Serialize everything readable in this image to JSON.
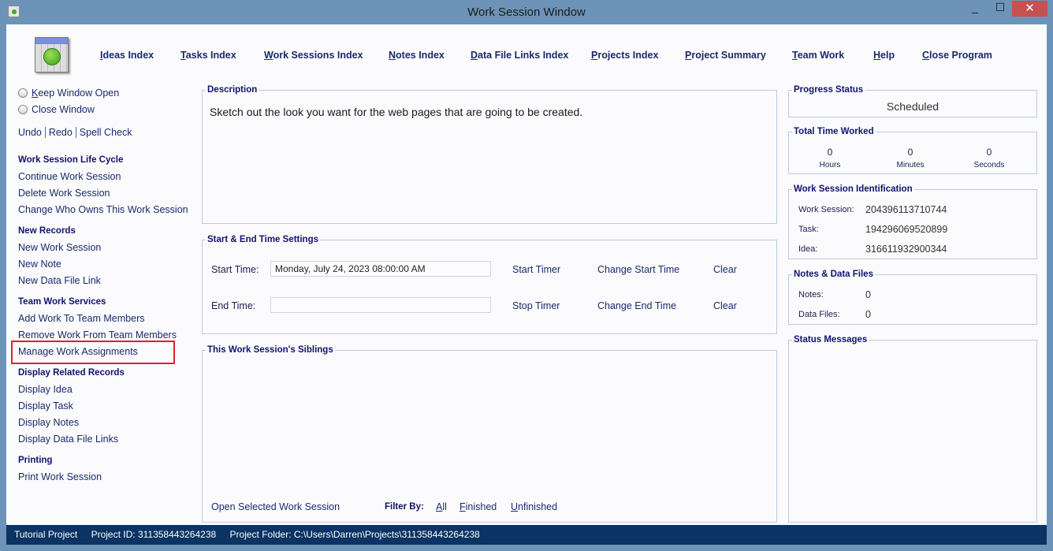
{
  "window": {
    "title": "Work Session Window",
    "minimize": "_",
    "maximize": "☐",
    "close": "✕"
  },
  "nav": [
    "Ideas Index",
    "Tasks Index",
    "Work Sessions Index",
    "Notes Index",
    "Data File Links Index",
    "Projects Index",
    "Project Summary",
    "Team Work",
    "Help",
    "Close Program"
  ],
  "left": {
    "keep_open": "Keep Window Open",
    "close_window": "Close Window",
    "undo": "Undo",
    "redo": "Redo",
    "spell": "Spell Check",
    "sections": [
      {
        "title": "Work Session Life Cycle",
        "items": [
          "Continue Work Session",
          "Delete Work Session",
          "Change Who Owns This Work Session"
        ]
      },
      {
        "title": "New Records",
        "items": [
          "New Work Session",
          "New Note",
          "New Data File Link"
        ]
      },
      {
        "title": "Team Work Services",
        "items": [
          "Add Work To Team Members",
          "Remove Work From Team Members",
          "Manage Work Assignments"
        ]
      },
      {
        "title": "Display Related Records",
        "items": [
          "Display Idea",
          "Display Task",
          "Display Notes",
          "Display Data File Links"
        ]
      },
      {
        "title": "Printing",
        "items": [
          "Print Work Session"
        ]
      }
    ],
    "highlight_color": "#e0202a"
  },
  "description": {
    "label": "Description",
    "text": "Sketch out the look you want for the web pages that are going to be created."
  },
  "times": {
    "label": "Start & End Time Settings",
    "start_label": "Start Time:",
    "start_value": "Monday, July 24, 2023   08:00:00 AM",
    "start_timer": "Start Timer",
    "change_start": "Change Start Time",
    "clear": "Clear",
    "end_label": "End Time:",
    "end_value": "",
    "stop_timer": "Stop Timer",
    "change_end": "Change End Time"
  },
  "siblings": {
    "label": "This Work Session's Siblings",
    "open": "Open Selected Work Session",
    "filter_by": "Filter By:",
    "all": "All",
    "finished": "Finished",
    "unfinished": "Unfinished"
  },
  "progress": {
    "label": "Progress Status",
    "value": "Scheduled"
  },
  "time_worked": {
    "label": "Total Time Worked",
    "hours": "0",
    "hours_label": "Hours",
    "minutes": "0",
    "minutes_label": "Minutes",
    "seconds": "0",
    "seconds_label": "Seconds"
  },
  "ident": {
    "label": "Work Session Identification",
    "ws_label": "Work Session:",
    "ws": "204396113710744",
    "task_label": "Task:",
    "task": "194296069520899",
    "idea_label": "Idea:",
    "idea": "316611932900344"
  },
  "notes": {
    "label": "Notes & Data Files",
    "notes_label": "Notes:",
    "notes": "0",
    "files_label": "Data Files:",
    "files": "0"
  },
  "status_messages": {
    "label": "Status Messages"
  },
  "statusbar": {
    "project": "Tutorial Project",
    "project_id": "Project ID:  311358443264238",
    "folder": "Project Folder: C:\\Users\\Darren\\Projects\\311358443264238"
  }
}
